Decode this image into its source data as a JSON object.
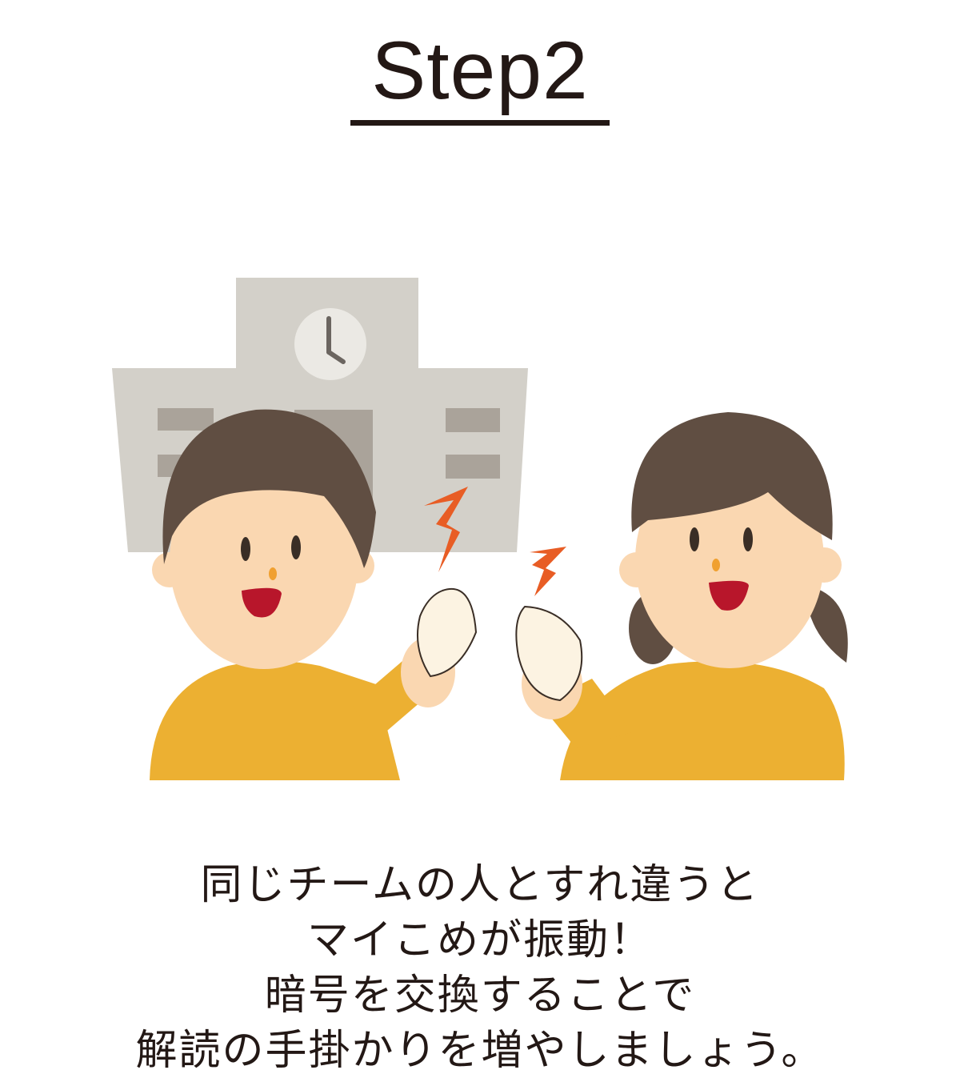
{
  "heading": {
    "title": "Step2"
  },
  "caption": {
    "lines": [
      "同じチームの人とすれ違うと",
      "マイこめが振動！",
      "暗号を交換することで",
      "解読の手掛かりを増やしましょう。"
    ]
  },
  "colors": {
    "text": "#231815",
    "building": "#d3d0c9",
    "window": "#aaa39a",
    "hair": "#604e42",
    "skin": "#fad7b1",
    "shirt": "#ecb032",
    "mouth": "#b8162b",
    "nose": "#f0a030",
    "spark": "#e85d25",
    "rice": "#fcf3e2"
  },
  "icons": [
    "school-building-icon",
    "clock-icon",
    "vibration-spark-icon",
    "rice-device-icon"
  ]
}
